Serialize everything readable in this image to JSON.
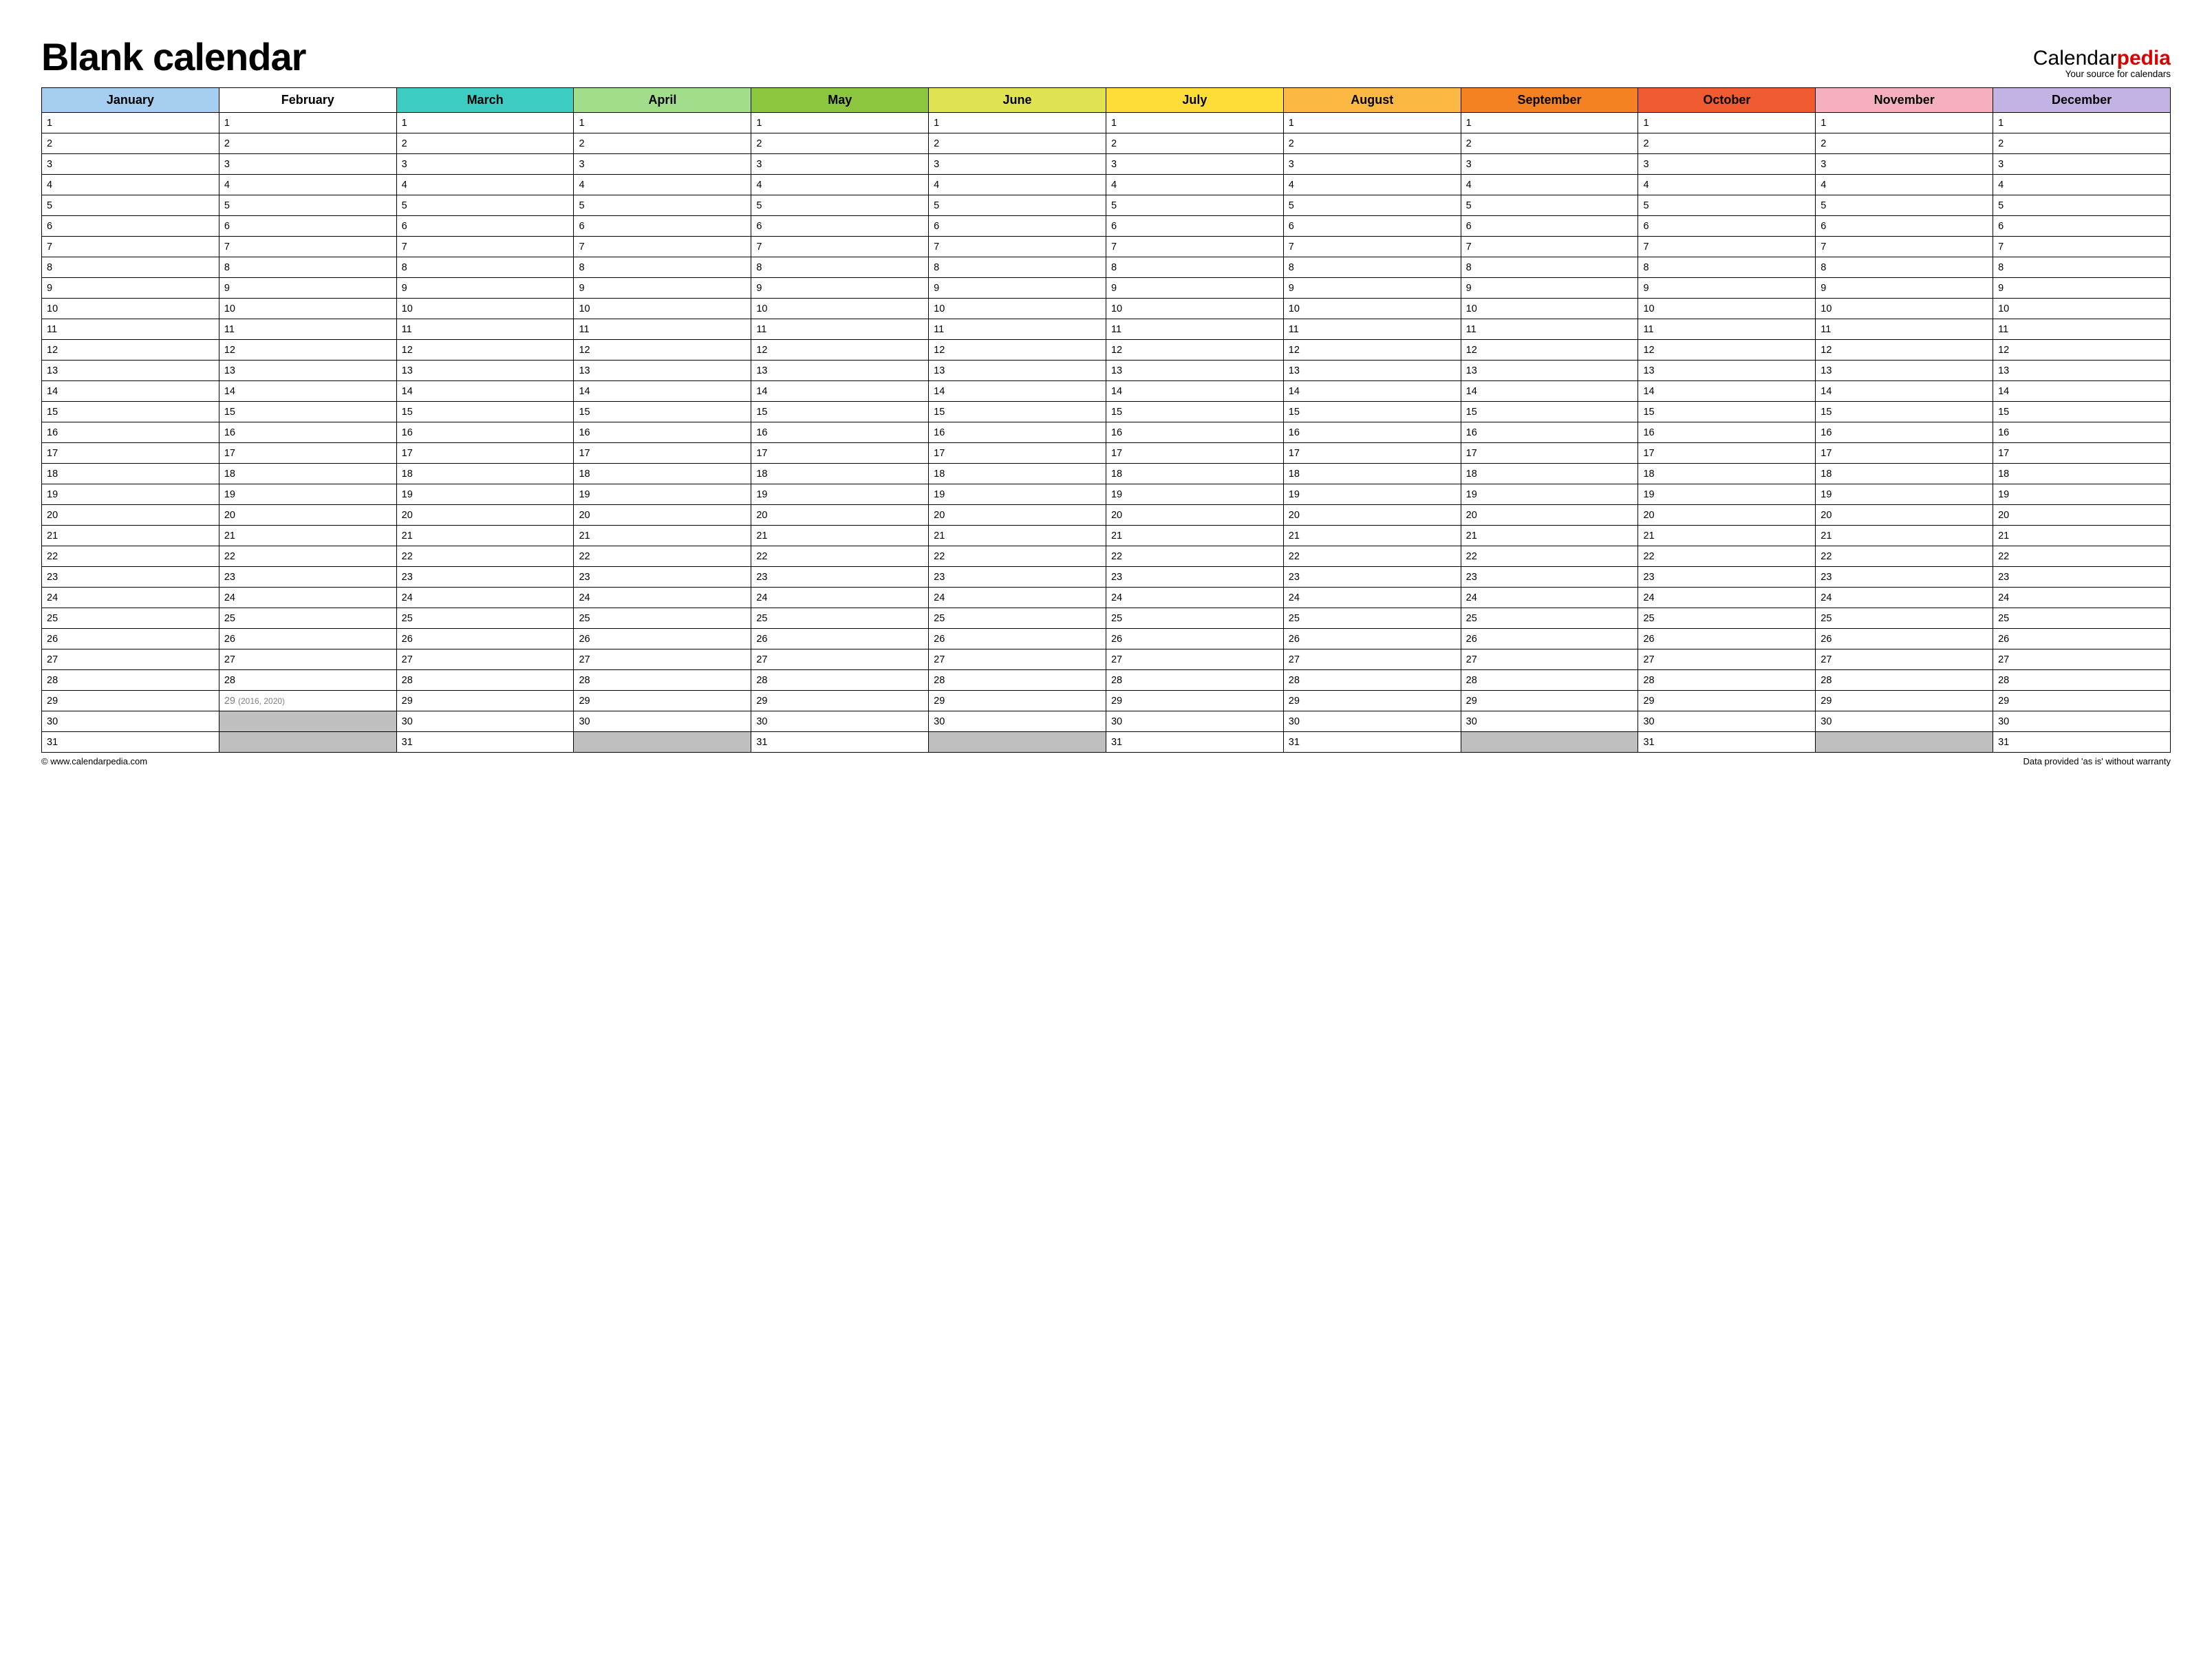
{
  "title": "Blank calendar",
  "brand": {
    "prefix": "Calendar",
    "accent": "pedia",
    "tagline": "Your source for calendars"
  },
  "months": [
    {
      "name": "January",
      "color": "#a5cef1",
      "days": 31
    },
    {
      "name": "February",
      "color": "#ffffff",
      "days": 29,
      "leap_day": 29,
      "leap_note": "(2016, 2020)"
    },
    {
      "name": "March",
      "color": "#3cccc2",
      "days": 31
    },
    {
      "name": "April",
      "color": "#a1dd8b",
      "days": 30
    },
    {
      "name": "May",
      "color": "#8cc63f",
      "days": 31
    },
    {
      "name": "June",
      "color": "#dfe352",
      "days": 30
    },
    {
      "name": "July",
      "color": "#fedd39",
      "days": 31
    },
    {
      "name": "August",
      "color": "#fbb843",
      "days": 31
    },
    {
      "name": "September",
      "color": "#f58222",
      "days": 30
    },
    {
      "name": "October",
      "color": "#f05a30",
      "days": 31
    },
    {
      "name": "November",
      "color": "#f6afbe",
      "days": 30
    },
    {
      "name": "December",
      "color": "#c3b2e4",
      "days": 31
    }
  ],
  "max_rows": 31,
  "footer": {
    "left": "© www.calendarpedia.com",
    "right": "Data provided 'as is' without warranty"
  }
}
